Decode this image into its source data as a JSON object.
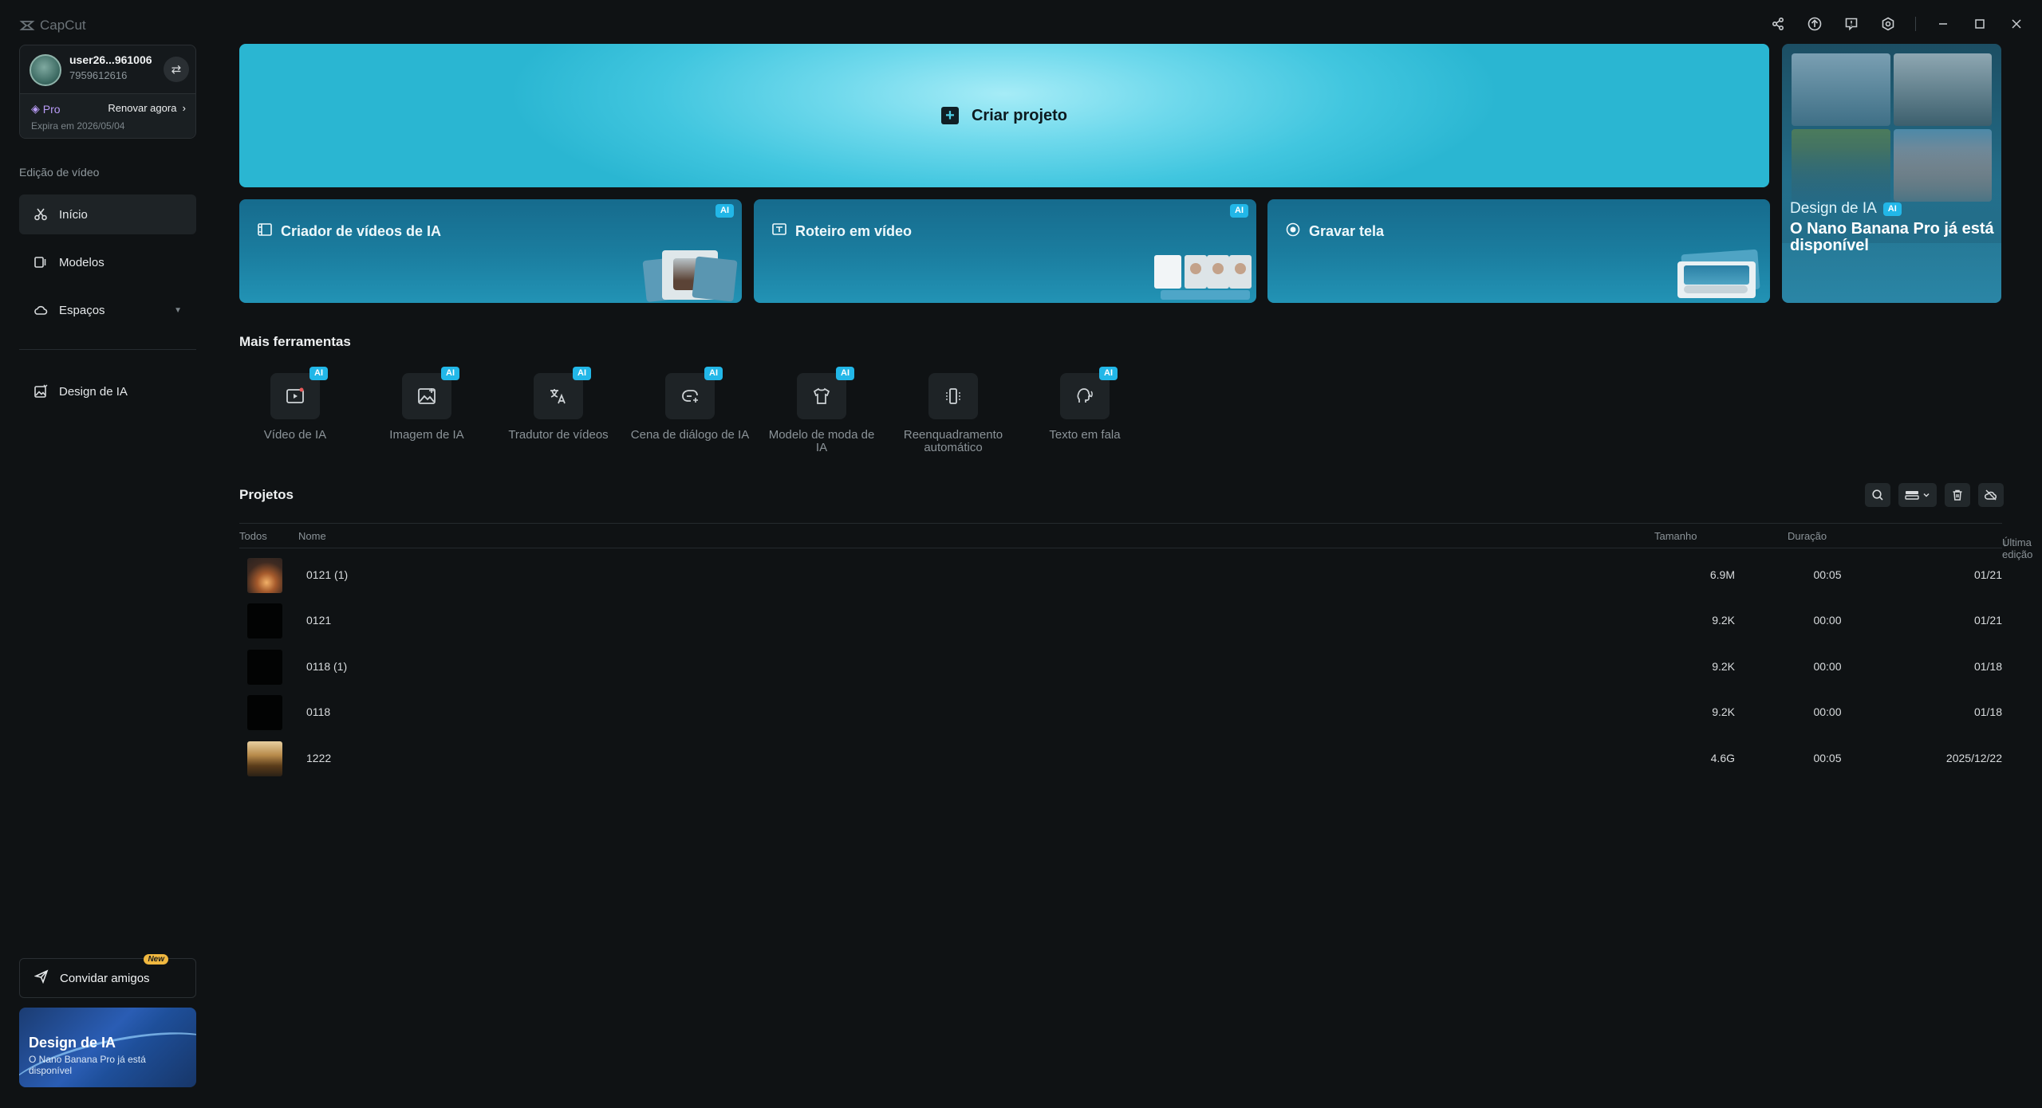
{
  "app": {
    "name": "CapCut"
  },
  "user": {
    "name": "user26...961006",
    "id": "7959612616",
    "plan": "Pro",
    "renew_label": "Renovar agora",
    "expiry": "Expira em 2026/05/04"
  },
  "sidebar": {
    "section_label": "Edição de vídeo",
    "items": [
      {
        "label": "Início",
        "icon": "scissors-icon",
        "active": true
      },
      {
        "label": "Modelos",
        "icon": "template-icon"
      },
      {
        "label": "Espaços",
        "icon": "cloud-icon"
      },
      {
        "label": "Design de IA",
        "icon": "image-edit-icon"
      }
    ],
    "invite_label": "Convidar amigos",
    "invite_badge": "New",
    "promo": {
      "title": "Design de IA",
      "subtitle": "O Nano Banana Pro já está disponível"
    }
  },
  "hero": {
    "label": "Criar projeto"
  },
  "tool_cards": [
    {
      "label": "Criador de vídeos de IA",
      "badge": "AI"
    },
    {
      "label": "Roteiro em vídeo",
      "badge": "AI"
    },
    {
      "label": "Gravar tela"
    }
  ],
  "banner": {
    "kicker": "Design de IA",
    "badge": "AI",
    "title": "O Nano Banana Pro já está disponível"
  },
  "more_tools": {
    "title": "Mais ferramentas",
    "items": [
      {
        "label": "Vídeo de IA",
        "badge": "AI",
        "icon": "ai-video-icon"
      },
      {
        "label": "Imagem de IA",
        "badge": "AI",
        "icon": "ai-image-icon"
      },
      {
        "label": "Tradutor de vídeos",
        "badge": "AI",
        "icon": "translate-icon"
      },
      {
        "label": "Cena de diálogo de IA",
        "badge": "AI",
        "icon": "dialogue-icon"
      },
      {
        "label": "Modelo de moda de IA",
        "badge": "AI",
        "icon": "shirt-icon"
      },
      {
        "label": "Reenquadramento automático",
        "icon": "reframe-icon"
      },
      {
        "label": "Texto em fala",
        "badge": "AI",
        "icon": "text-to-speech-icon"
      }
    ]
  },
  "projects": {
    "title": "Projetos",
    "columns": {
      "all": "Todos",
      "name": "Nome",
      "size": "Tamanho",
      "duration": "Duração",
      "last_edit": "Última edição"
    },
    "rows": [
      {
        "name": "0121 (1)",
        "size": "6.9M",
        "duration": "00:05",
        "last_edit": "01/21"
      },
      {
        "name": "0121",
        "size": "9.2K",
        "duration": "00:00",
        "last_edit": "01/21"
      },
      {
        "name": "0118 (1)",
        "size": "9.2K",
        "duration": "00:00",
        "last_edit": "01/18"
      },
      {
        "name": "0118",
        "size": "9.2K",
        "duration": "00:00",
        "last_edit": "01/18"
      },
      {
        "name": "1222",
        "size": "4.6G",
        "duration": "00:05",
        "last_edit": "2025/12/22"
      }
    ]
  }
}
